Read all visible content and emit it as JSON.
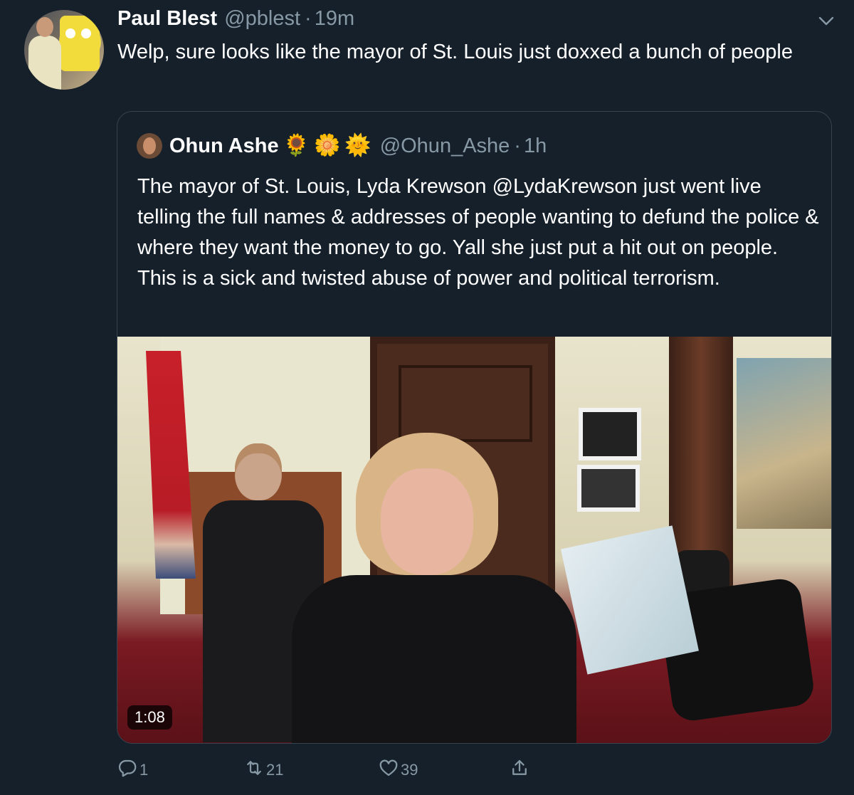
{
  "tweet": {
    "author": {
      "display_name": "Paul Blest",
      "handle": "@pblest",
      "separator": "·",
      "time": "19m"
    },
    "text": "Welp, sure looks like the mayor of St. Louis just doxxed a bunch of people",
    "quoted": {
      "display_name": "Ohun Ashe",
      "emojis": [
        "🌻",
        "🌼",
        "🌞"
      ],
      "handle": "@Ohun_Ashe",
      "separator": "·",
      "time": "1h",
      "text": "The mayor of St. Louis, Lyda Krewson @LydaKrewson just went live telling the full names & addresses of people wanting to defund the police & where they want the money to go. Yall she just put a hit out on people. This is a sick and twisted abuse of power and political terrorism.",
      "video": {
        "duration": "1:08"
      }
    },
    "actions": {
      "reply_count": "1",
      "retweet_count": "21",
      "like_count": "39"
    }
  },
  "icons": {
    "more": "chevron-down-icon",
    "reply": "reply-icon",
    "retweet": "retweet-icon",
    "like": "heart-icon",
    "share": "share-icon"
  },
  "colors": {
    "background": "#15202b",
    "secondary_text": "#8899a6",
    "border": "#38444d"
  }
}
